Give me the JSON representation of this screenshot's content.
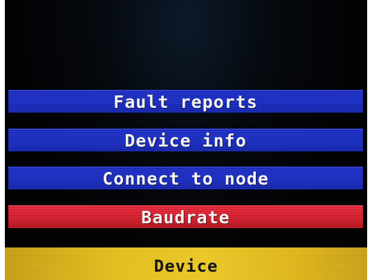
{
  "menu": {
    "items": [
      {
        "label": "Fault reports",
        "selected": false
      },
      {
        "label": "Device info",
        "selected": false
      },
      {
        "label": "Connect to node",
        "selected": false
      },
      {
        "label": "Baudrate",
        "selected": true
      }
    ]
  },
  "footer": {
    "title": "Device"
  },
  "colors": {
    "item_blue": "#1a2ec6",
    "item_selected_red": "#d81f2e",
    "footer_yellow": "#e8c21d",
    "background": "#020203"
  }
}
